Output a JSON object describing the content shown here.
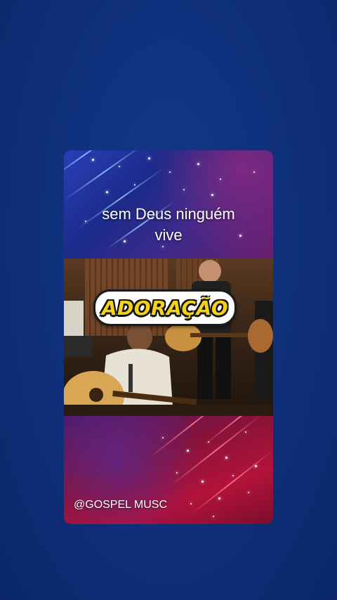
{
  "video_card": {
    "lyric_line1": "sem Deus ninguém",
    "lyric_line2": "vive",
    "badge_text": "ADORAÇÃO",
    "watermark": "@GOSPEL MUSC"
  },
  "colors": {
    "background": "#0f2f7a",
    "badge_text": "#f5d21a",
    "top_panel": "#2a3fb8",
    "bottom_panel": "#b3123a"
  }
}
